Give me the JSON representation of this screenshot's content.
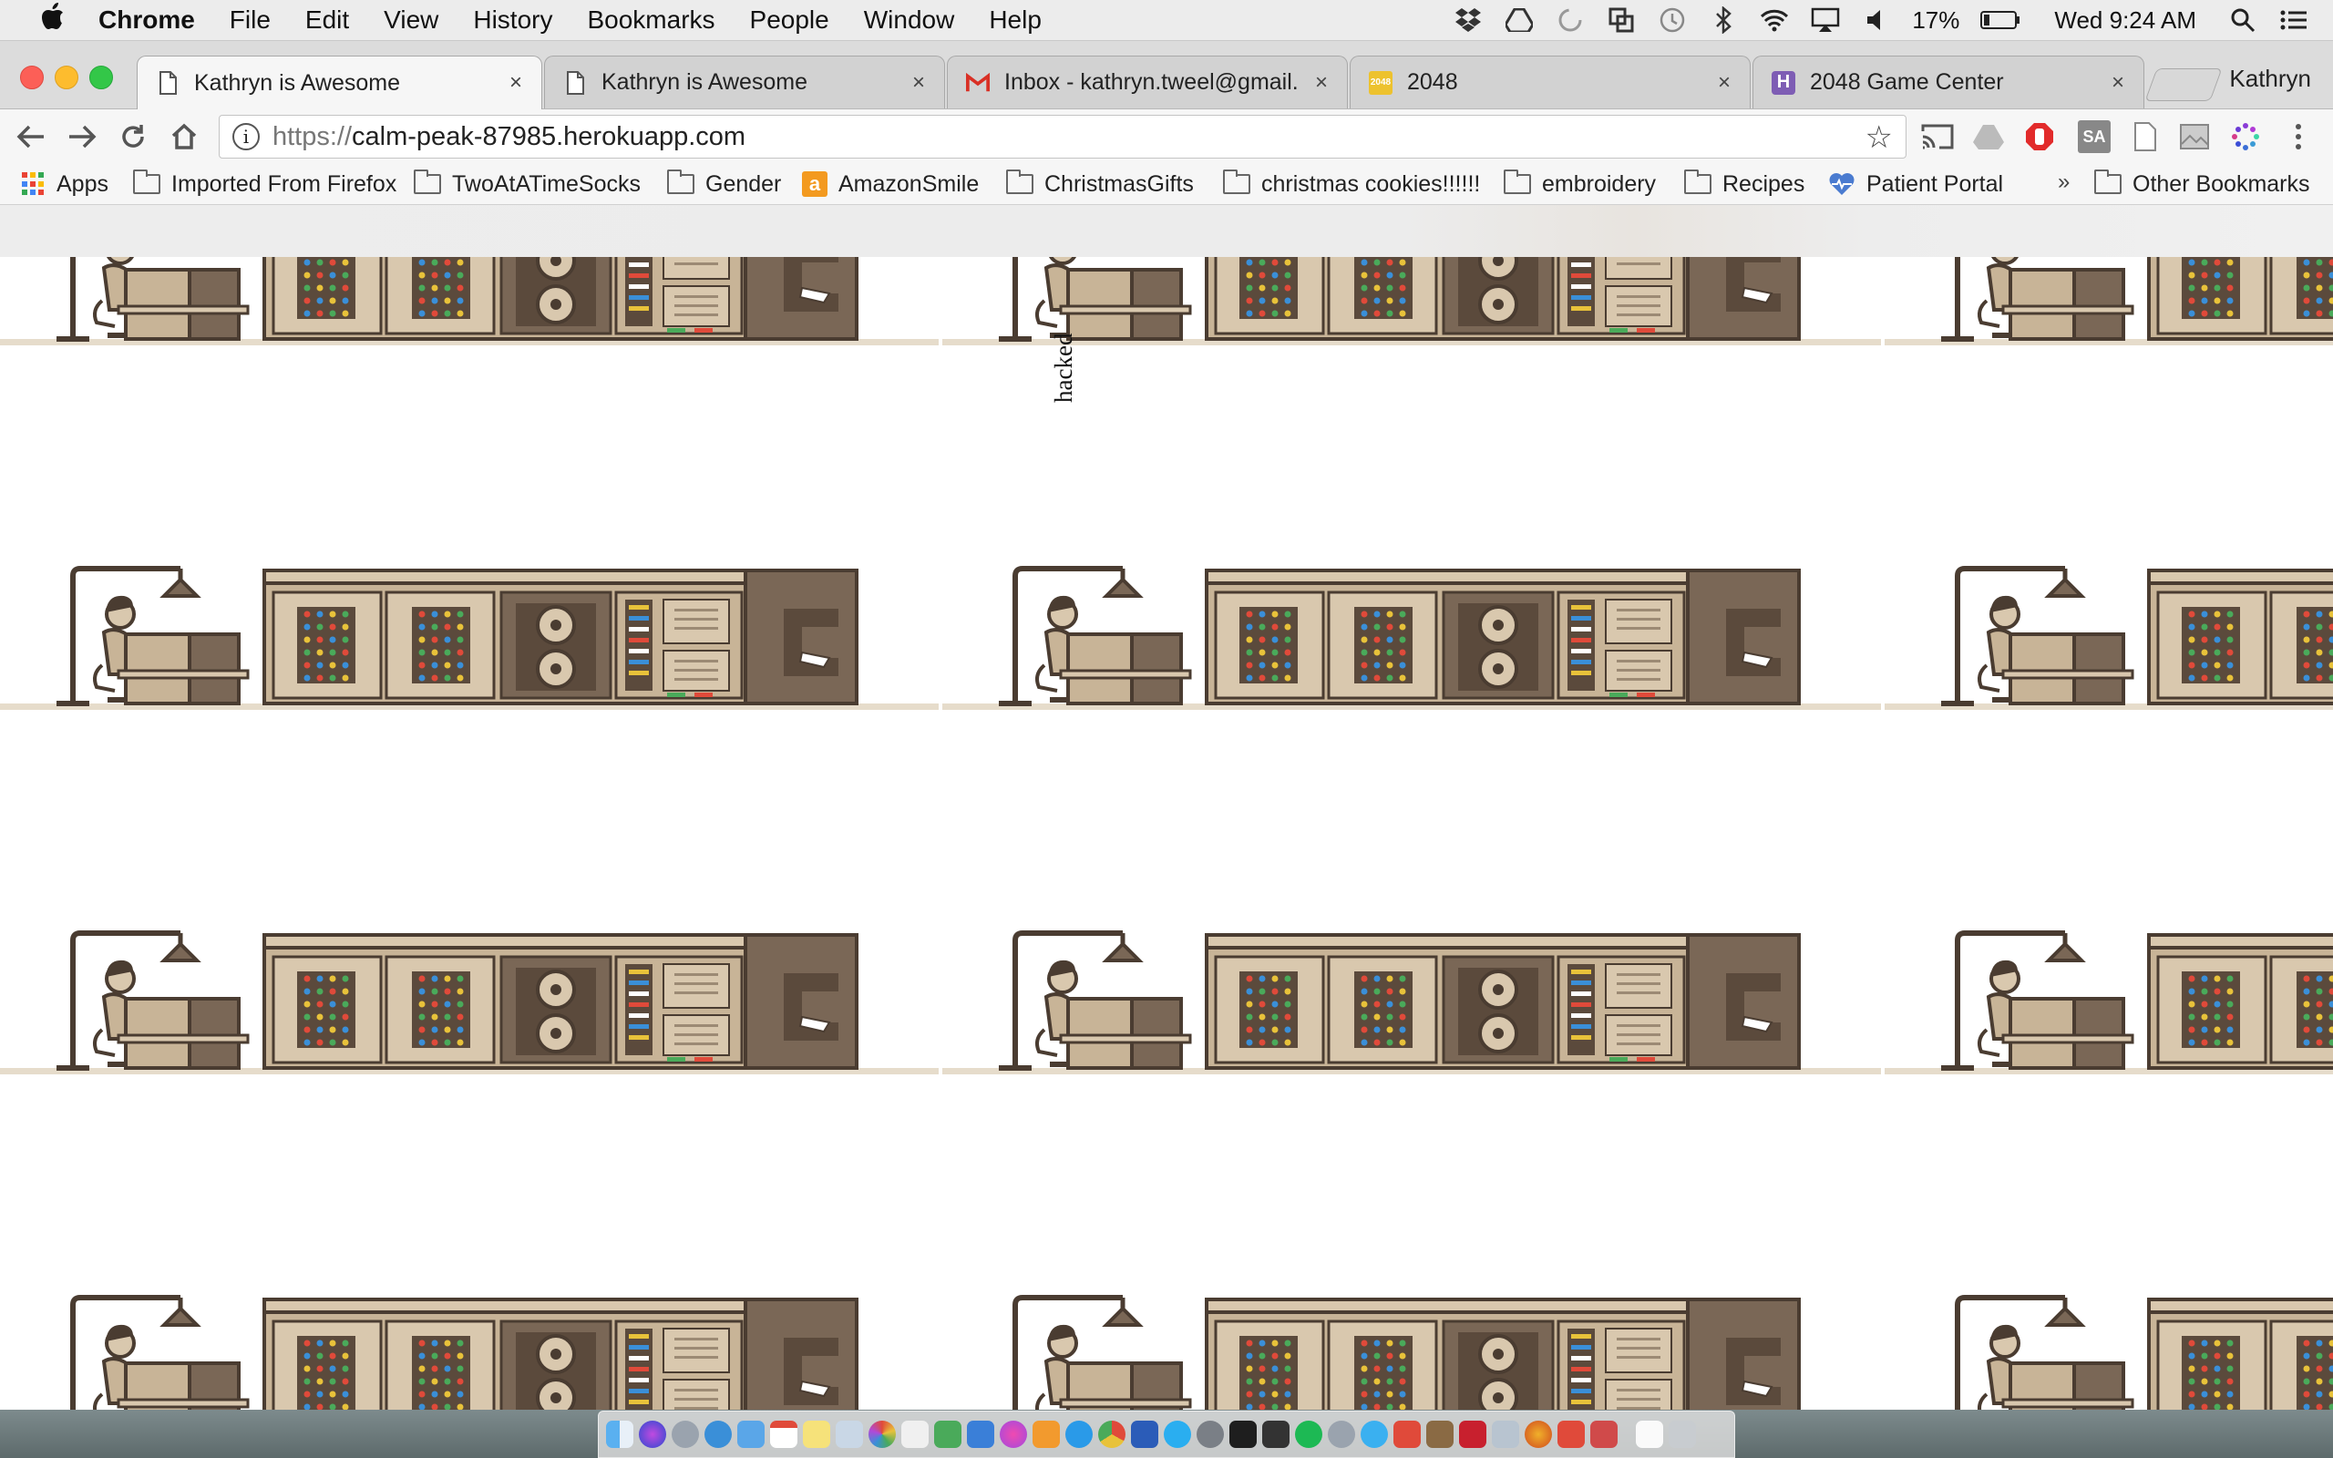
{
  "menubar": {
    "app_name": "Chrome",
    "items": [
      "File",
      "Edit",
      "View",
      "History",
      "Bookmarks",
      "People",
      "Window",
      "Help"
    ],
    "battery_percent": "17%",
    "clock": "Wed 9:24 AM"
  },
  "tabs": [
    {
      "title": "Kathryn is Awesome",
      "favicon": "page-icon",
      "active": true
    },
    {
      "title": "Kathryn is Awesome",
      "favicon": "page-icon",
      "active": false
    },
    {
      "title": "Inbox - kathryn.tweel@gmail.",
      "favicon": "gmail-icon",
      "active": false
    },
    {
      "title": "2048",
      "favicon": "2048-icon",
      "favicon_text": "2048",
      "active": false
    },
    {
      "title": "2048 Game Center",
      "favicon": "heroku-icon",
      "favicon_text": "H",
      "active": false
    }
  ],
  "profile_name": "Kathryn",
  "address": {
    "scheme": "https://",
    "host": "calm-peak-87985.herokuapp.com"
  },
  "bookmarks": {
    "items": [
      {
        "label": "Apps",
        "icon": "apps-grid-icon"
      },
      {
        "label": "Imported From Firefox",
        "icon": "folder-icon"
      },
      {
        "label": "TwoAtATimeSocks",
        "icon": "folder-icon"
      },
      {
        "label": "Gender",
        "icon": "folder-icon"
      },
      {
        "label": "AmazonSmile",
        "icon": "amazon-icon",
        "icon_text": "a"
      },
      {
        "label": "ChristmasGifts",
        "icon": "folder-icon"
      },
      {
        "label": "christmas cookies!!!!!!",
        "icon": "folder-icon"
      },
      {
        "label": "embroidery",
        "icon": "folder-icon"
      },
      {
        "label": "Recipes",
        "icon": "folder-icon"
      },
      {
        "label": "Patient Portal",
        "icon": "heart-pulse-icon"
      }
    ],
    "overflow": "»",
    "other": "Other Bookmarks"
  },
  "page": {
    "overlay_text": "hacked",
    "tile_image": "programmer-at-mainframe-computer-illustration"
  },
  "colors": {
    "accent_tan": "#c8b497",
    "dark_brown": "#5b4a3c",
    "mid_brown": "#7a6756",
    "light_tan": "#d9c8ae"
  }
}
